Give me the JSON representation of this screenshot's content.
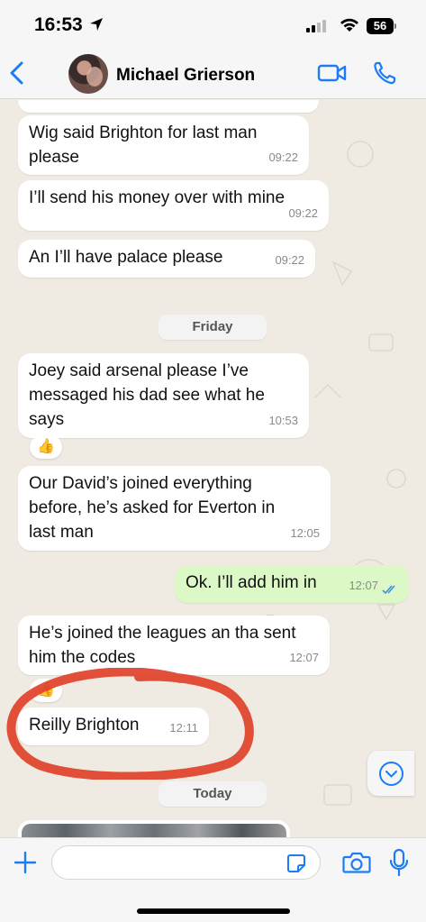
{
  "status_bar": {
    "time": "16:53",
    "battery": "56"
  },
  "header": {
    "contact_name": "Michael Grierson"
  },
  "messages": [
    {
      "text": "Wig said Brighton for last man\nplease",
      "time": "09:22",
      "direction": "in"
    },
    {
      "text": "I’ll send his money over with mine",
      "time": "09:22",
      "direction": "in"
    },
    {
      "text": "An I’ll have palace please",
      "time": "09:22",
      "direction": "in"
    },
    {
      "text": "Joey said arsenal please I’ve\nmessaged his dad see what he\nsays",
      "time": "10:53",
      "direction": "in",
      "reaction": "👍"
    },
    {
      "text": "Our David’s joined everything\nbefore, he’s asked for Everton in\nlast man",
      "time": "12:05",
      "direction": "in"
    },
    {
      "text": "Ok. I’ll add him in",
      "time": "12:07",
      "direction": "out",
      "read": true
    },
    {
      "text": "He’s joined the leagues an tha sent\nhim the codes",
      "time": "12:07",
      "direction": "in",
      "reaction": "👍"
    },
    {
      "text": "Reilly Brighton",
      "time": "12:11",
      "direction": "in"
    }
  ],
  "day_separators": [
    "Friday",
    "Today"
  ],
  "annotation_color": "#e0412a",
  "accent_color": "#1c7cf4",
  "outgoing_bubble_color": "#dcf8c6",
  "input": {
    "placeholder": "",
    "value": ""
  },
  "icons": [
    "back-chevron-icon",
    "video-call-icon",
    "phone-call-icon",
    "plus-icon",
    "sticker-icon",
    "camera-icon",
    "microphone-icon",
    "scroll-down-icon"
  ]
}
